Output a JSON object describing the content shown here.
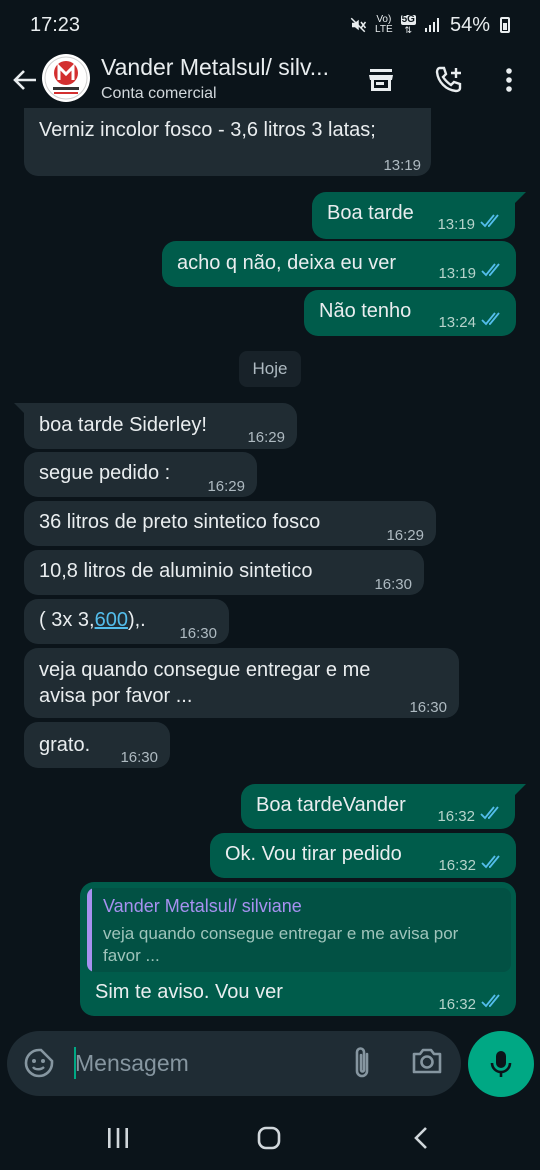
{
  "status_bar": {
    "time": "17:23",
    "network_vol": "Vo)",
    "network_lte": "LTE",
    "network_5g": "5G",
    "battery": "54%"
  },
  "header": {
    "contact_name": "Vander Metalsul/ silv...",
    "subtitle": "Conta comercial",
    "avatar_text": "METALSUL",
    "icons": [
      "back-arrow-icon",
      "store-icon",
      "add-call-icon",
      "more-vert-icon"
    ]
  },
  "messages": [
    {
      "dir": "in",
      "text": "Verniz incolor fosco - 3,6 litros 3 latas;",
      "time": "13:19"
    },
    {
      "dir": "out",
      "text": "Boa tarde",
      "time": "13:19",
      "status": "read"
    },
    {
      "dir": "out",
      "text": "acho q não,  deixa eu ver",
      "time": "13:19",
      "status": "read"
    },
    {
      "dir": "out",
      "text": "Não tenho",
      "time": "13:24",
      "status": "read"
    },
    {
      "dir": "in",
      "text": "boa tarde Siderley!",
      "time": "16:29"
    },
    {
      "dir": "in",
      "text": "segue pedido :",
      "time": "16:29"
    },
    {
      "dir": "in",
      "text": "36 litros de preto sintetico fosco",
      "time": "16:29"
    },
    {
      "dir": "in",
      "text": "10,8 litros de aluminio sintetico",
      "time": "16:30"
    },
    {
      "dir": "in",
      "text_before": "( 3x 3,",
      "text_link": "600",
      "text_after": "),.",
      "time": "16:30"
    },
    {
      "dir": "in",
      "line1": "veja quando consegue entregar e me",
      "line2": "avisa por favor ...",
      "time": "16:30"
    },
    {
      "dir": "in",
      "text": "grato.",
      "time": "16:30"
    },
    {
      "dir": "out",
      "text": "Boa tardeVander",
      "time": "16:32",
      "status": "read"
    },
    {
      "dir": "out",
      "text": "Ok. Vou tirar pedido",
      "time": "16:32",
      "status": "read"
    },
    {
      "dir": "out",
      "text": "Sim te aviso.  Vou ver",
      "time": "16:32",
      "status": "read",
      "quote": {
        "author": "Vander Metalsul/ silviane",
        "text": "veja quando consegue entregar e me avisa por favor ..."
      }
    }
  ],
  "date_divider": "Hoje",
  "composer": {
    "placeholder": "Mensagem"
  },
  "colors": {
    "background": "#0b141a",
    "incoming_bubble": "#202c33",
    "outgoing_bubble": "#005c4b",
    "accent": "#00a884",
    "read_ticks": "#53bdeb",
    "quote_author": "#a791f0"
  }
}
